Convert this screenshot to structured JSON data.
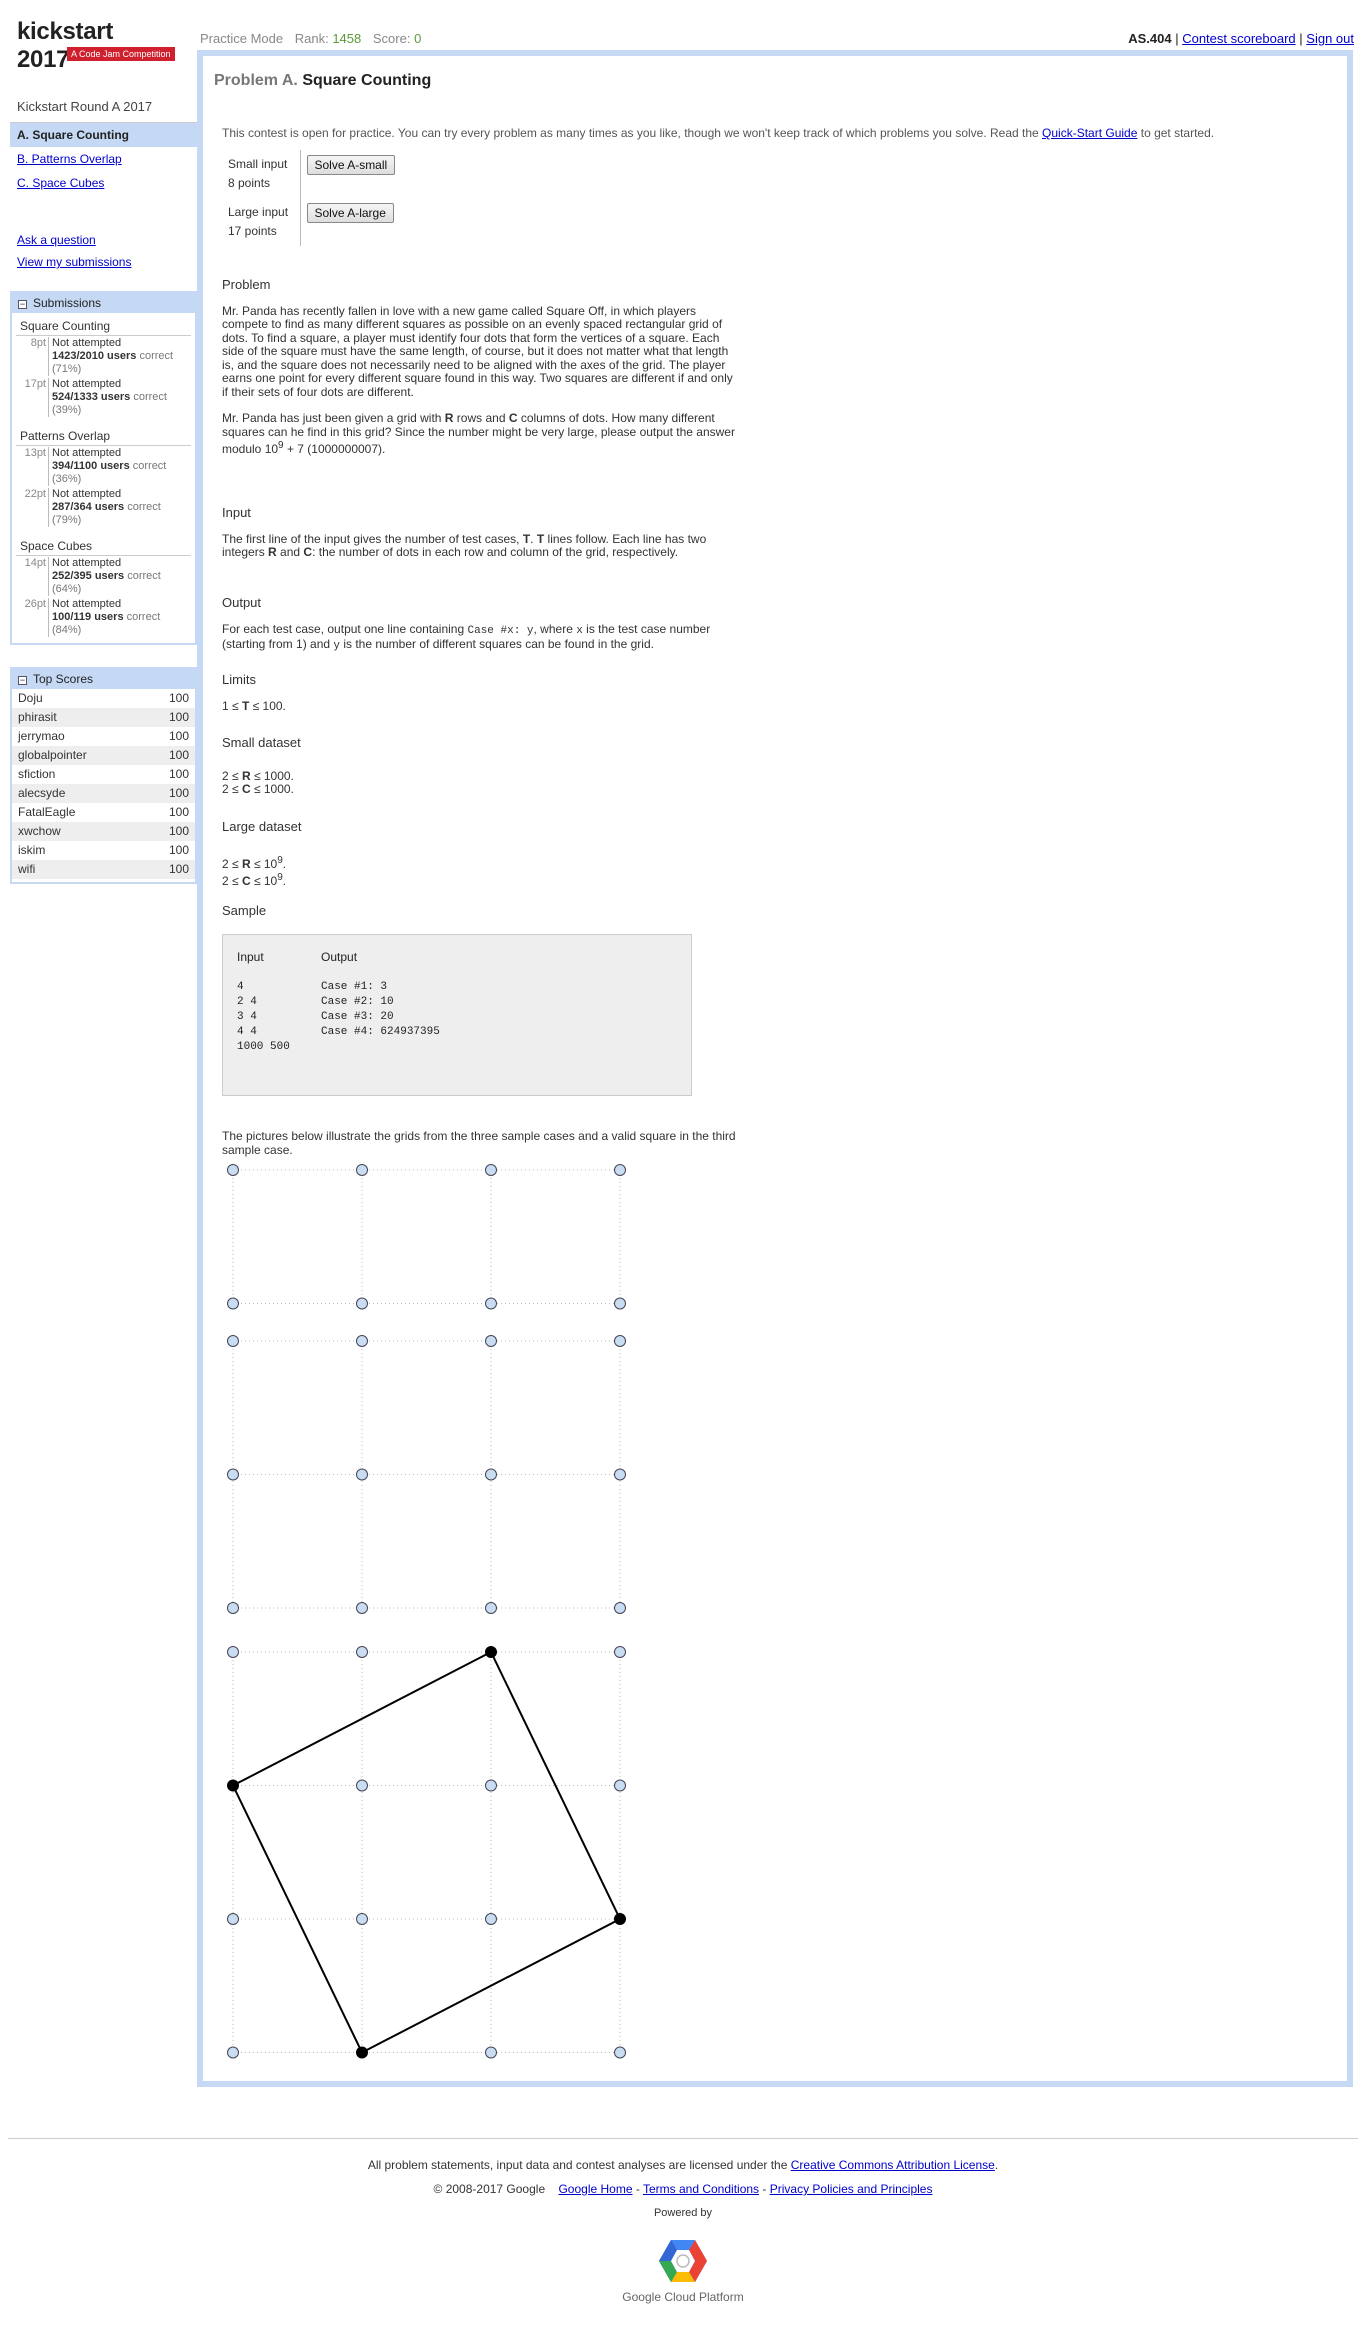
{
  "header": {
    "logo_title": "kickstart 2017",
    "logo_subtitle": "A Code Jam Competition",
    "mode": "Practice Mode",
    "rank_label": "Rank:",
    "rank_value": "1458",
    "score_label": "Score:",
    "score_value": "0",
    "user": "AS.404",
    "scoreboard_link": "Contest scoreboard",
    "separator": "|",
    "signout_link": "Sign out"
  },
  "sidebar": {
    "round_title": "Kickstart Round A 2017",
    "problems": [
      {
        "label": "A. Square Counting",
        "active": true
      },
      {
        "label": "B. Patterns Overlap",
        "active": false
      },
      {
        "label": "C. Space Cubes",
        "active": false
      }
    ],
    "ask_question": "Ask a question",
    "view_submissions": "View my submissions",
    "submissions": {
      "title": "Submissions",
      "toggle": "−",
      "problems": [
        {
          "name": "Square Counting",
          "rows": [
            {
              "points": "8pt",
              "status": "Not attempted",
              "counts": "1423/2010 users",
              "suffix": "correct",
              "pct": "(71%)"
            },
            {
              "points": "17pt",
              "status": "Not attempted",
              "counts": "524/1333 users",
              "suffix": "correct",
              "pct": "(39%)"
            }
          ]
        },
        {
          "name": "Patterns Overlap",
          "rows": [
            {
              "points": "13pt",
              "status": "Not attempted",
              "counts": "394/1100 users",
              "suffix": "correct",
              "pct": "(36%)"
            },
            {
              "points": "22pt",
              "status": "Not attempted",
              "counts": "287/364 users",
              "suffix": "correct",
              "pct": "(79%)"
            }
          ]
        },
        {
          "name": "Space Cubes",
          "rows": [
            {
              "points": "14pt",
              "status": "Not attempted",
              "counts": "252/395 users",
              "suffix": "correct",
              "pct": "(64%)"
            },
            {
              "points": "26pt",
              "status": "Not attempted",
              "counts": "100/119 users",
              "suffix": "correct",
              "pct": "(84%)"
            }
          ]
        }
      ]
    },
    "top_scores": {
      "title": "Top Scores",
      "toggle": "−",
      "rows": [
        {
          "name": "Doju",
          "score": "100"
        },
        {
          "name": "phirasit",
          "score": "100"
        },
        {
          "name": "jerrymao",
          "score": "100"
        },
        {
          "name": "globalpointer",
          "score": "100"
        },
        {
          "name": "sfiction",
          "score": "100"
        },
        {
          "name": "alecsyde",
          "score": "100"
        },
        {
          "name": "FatalEagle",
          "score": "100"
        },
        {
          "name": "xwchow",
          "score": "100"
        },
        {
          "name": "iskim",
          "score": "100"
        },
        {
          "name": "wifi",
          "score": "100"
        }
      ]
    }
  },
  "problem": {
    "prefix": "Problem A.",
    "title": "Square Counting",
    "intro_before": "This contest is open for practice. You can try every problem as many times as you like, though we won't keep track of which problems you solve. Read the ",
    "intro_link": "Quick-Start Guide",
    "intro_after": " to get started.",
    "small_label": "Small input",
    "small_points": "8 points",
    "small_button": "Solve A-small",
    "large_label": "Large input",
    "large_points": "17 points",
    "large_button": "Solve A-large",
    "statement": {
      "problem_heading": "Problem",
      "para1": "Mr. Panda has recently fallen in love with a new game called Square Off, in which players compete to find as many different squares as possible on an evenly spaced rectangular grid of dots. To find a square, a player must identify four dots that form the vertices of a square. Each side of the square must have the same length, of course, but it does not matter what that length is, and the square does not necessarily need to be aligned with the axes of the grid. The player earns one point for every different square found in this way. Two squares are different if and only if their sets of four dots are different.",
      "para2_a": "Mr. Panda has just been given a grid with ",
      "para2_R": "R",
      "para2_b": " rows and ",
      "para2_C": "C",
      "para2_c": " columns of dots. How many different squares can he find in this grid? Since the number might be very large, please output the answer modulo 10",
      "para2_sup": "9",
      "para2_d": " + 7 (1000000007).",
      "input_heading": "Input",
      "input_a": "The first line of the input gives the number of test cases, ",
      "input_T1": "T",
      "input_b": ". ",
      "input_T2": "T",
      "input_c": " lines follow. Each line has two integers ",
      "input_R": "R",
      "input_d": " and ",
      "input_C": "C",
      "input_e": ": the number of dots in each row and column of the grid, respectively.",
      "output_heading": "Output",
      "output_a": "For each test case, output one line containing ",
      "output_code1": "Case #x: y",
      "output_b": ", where ",
      "output_code2": "x",
      "output_c": " is the test case number (starting from 1) and ",
      "output_code3": "y",
      "output_d": " is the number of different squares can be found in the grid.",
      "limits_heading": "Limits",
      "limits_a": "1 ≤ ",
      "limits_T": "T",
      "limits_b": " ≤ 100.",
      "small_heading": "Small dataset",
      "small_r_a": "2 ≤ ",
      "small_r_R": "R",
      "small_r_b": " ≤ 1000.",
      "small_c_a": "2 ≤ ",
      "small_c_C": "C",
      "small_c_b": " ≤ 1000.",
      "large_heading": "Large dataset",
      "large_r_a": "2 ≤ ",
      "large_r_R": "R",
      "large_r_b": " ≤ 10",
      "large_r_sup": "9",
      "large_r_c": ".",
      "large_c_a": "2 ≤ ",
      "large_c_C": "C",
      "large_c_b": " ≤ 10",
      "large_c_sup": "9",
      "large_c_c": ".",
      "sample_heading": "Sample",
      "sample_input_header": "Input",
      "sample_output_header": "Output",
      "sample_input": "4\n2 4\n3 4\n4 4\n1000 500",
      "sample_output": "Case #1: 3\nCase #2: 10\nCase #3: 20\nCase #4: 624937395",
      "pictures_caption": "The pictures below illustrate the grids from the three sample cases and a valid square in the third sample case."
    },
    "grids": [
      {
        "rows": 2,
        "cols": 4
      },
      {
        "rows": 3,
        "cols": 4
      },
      {
        "rows": 4,
        "cols": 4,
        "square": [
          [
            0,
            2
          ],
          [
            1,
            0
          ],
          [
            3,
            1
          ],
          [
            2,
            3
          ]
        ]
      }
    ]
  },
  "footer": {
    "license_text": "All problem statements, input data and contest analyses are licensed under the ",
    "license_link": "Creative Commons Attribution License",
    "license_end": ".",
    "copyright": "© 2008-2017 Google",
    "google_home": "Google Home",
    "dash": "-",
    "terms": "Terms and Conditions",
    "privacy": "Privacy Policies and Principles",
    "powered_by": "Powered by",
    "gcp": "Google Cloud Platform"
  },
  "colors": {
    "accent_blue": "#c5d9f5",
    "logo_red": "#d0202e",
    "rank_green": "#5a9a3a",
    "link": "#0000cc",
    "dot_fill": "#c8dcf2",
    "dot_filled": "#000000"
  }
}
